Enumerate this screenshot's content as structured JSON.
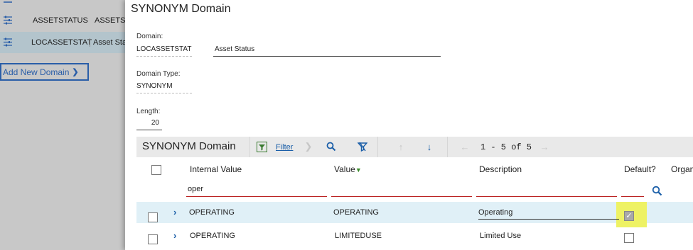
{
  "background": {
    "rows": [
      {
        "col1": "ASSETSTATUS",
        "col2": "ASSETST"
      },
      {
        "col1": "LOCASSETSTAT",
        "col2": "Asset Sta"
      }
    ],
    "add_domain_label": "Add New Domain"
  },
  "dialog": {
    "title": "SYNONYM Domain",
    "domain_label": "Domain:",
    "domain_value": "LOCASSETSTATI",
    "domain_desc": "Asset Status",
    "type_label": "Domain Type:",
    "type_value": "SYNONYM",
    "length_label": "Length:",
    "length_value": "20"
  },
  "table": {
    "title": "SYNONYM Domain",
    "filter_label": "Filter",
    "pager": "1 - 5 of 5",
    "columns": [
      "Internal Value",
      "Value",
      "Description",
      "Default?",
      "Organ"
    ],
    "filters": {
      "internal_value": "oper"
    },
    "rows": [
      {
        "internal_value": "OPERATING",
        "value": "OPERATING",
        "description": "Operating",
        "default": true
      },
      {
        "internal_value": "OPERATING",
        "value": "LIMITEDUSE",
        "description": "Limited Use",
        "default": false
      }
    ]
  },
  "colors": {
    "accent": "#1a5ea8",
    "highlight": "#eef264",
    "selected_row": "#e0f0f7"
  }
}
